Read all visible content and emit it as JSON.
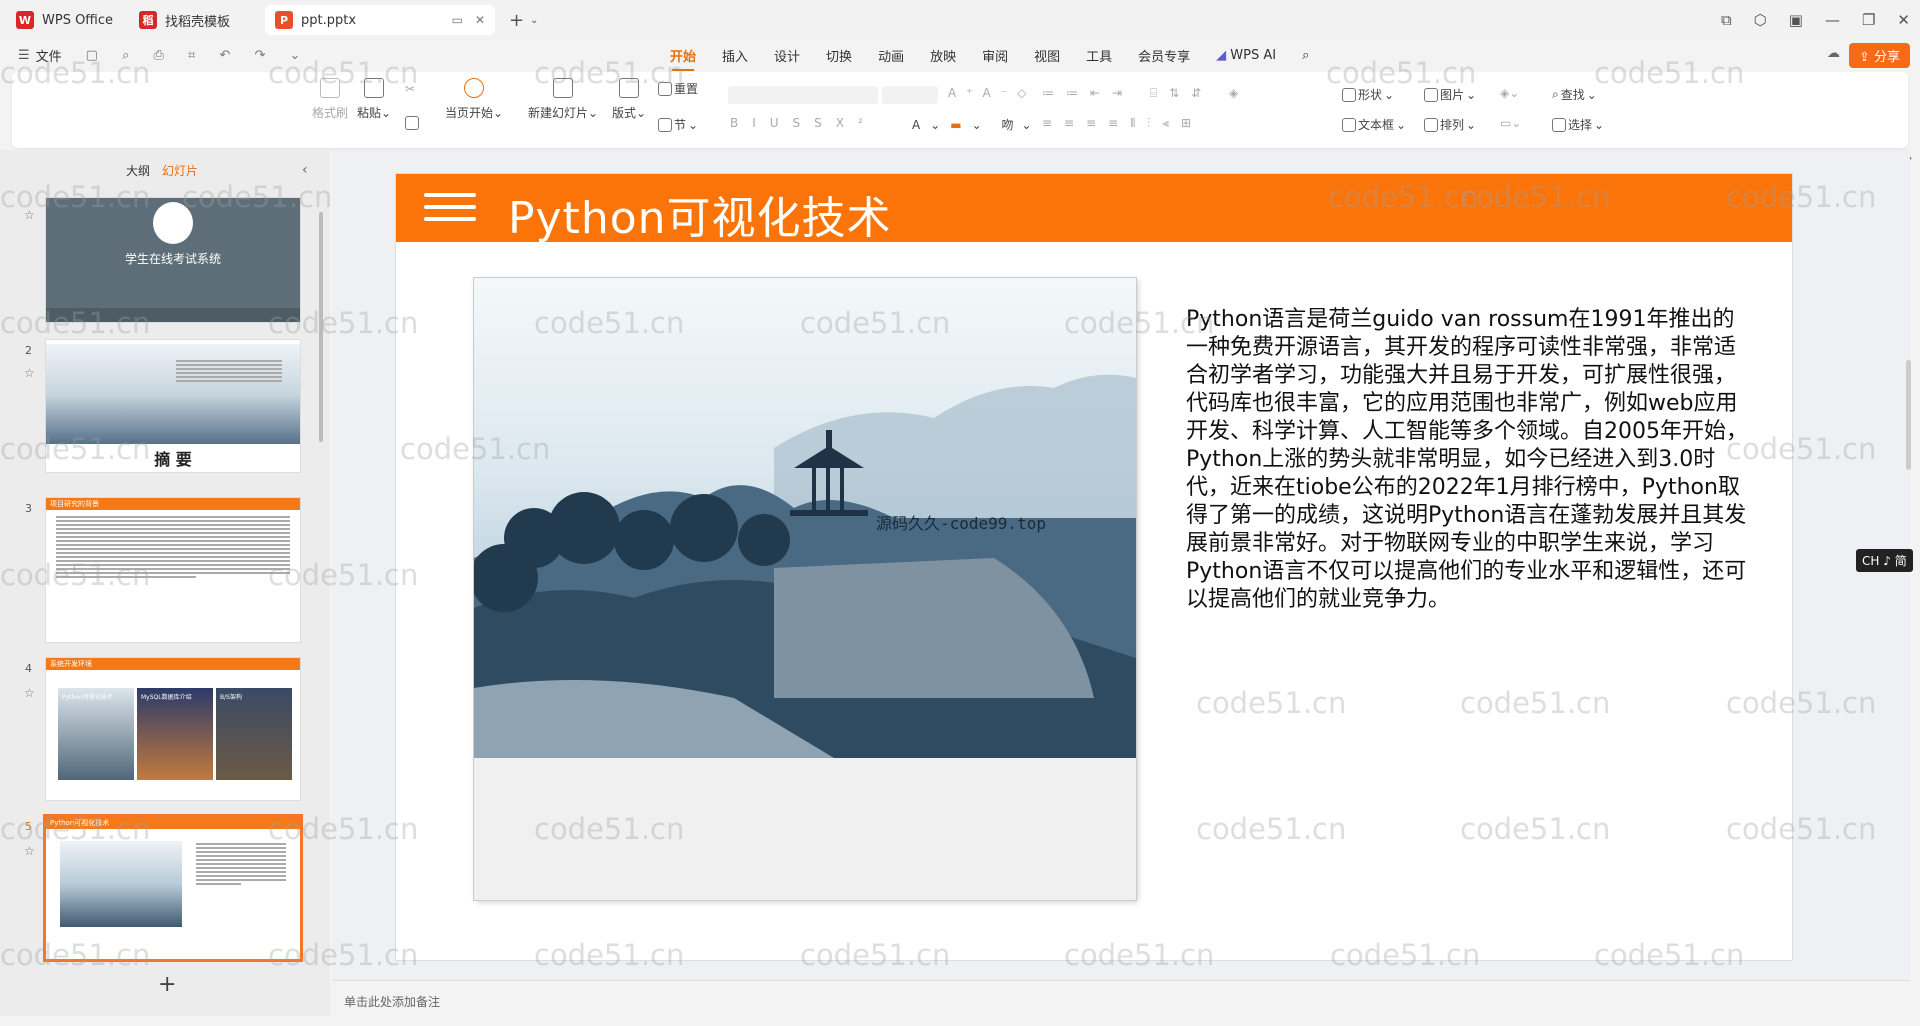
{
  "tabs": [
    {
      "label": "WPS Office",
      "logo": "W",
      "color": "#d9262b"
    },
    {
      "label": "找稻壳模板",
      "logo": "稻",
      "color": "#d9262b"
    },
    {
      "label": "ppt.pptx",
      "logo": "P",
      "color": "#e8502b"
    }
  ],
  "menu": {
    "file": "文件",
    "ribbon_tabs": [
      "开始",
      "插入",
      "设计",
      "切换",
      "动画",
      "放映",
      "审阅",
      "视图",
      "工具",
      "会员专享"
    ],
    "wps_ai": "WPS AI",
    "share": "分享"
  },
  "ribbon": {
    "format_painter": "格式刷",
    "paste": "粘贴",
    "from_current": "当页开始",
    "new_slide": "新建幻灯片",
    "layout": "版式",
    "reset": "重置",
    "section": "节",
    "shape": "形状",
    "picture": "图片",
    "textbox": "文本框",
    "arrange": "排列",
    "find": "查找",
    "select": "选择"
  },
  "sidebar": {
    "outline": "大纲",
    "slides": "幻灯片",
    "thumbs": [
      {
        "num": "",
        "title": "学生在线考试系统"
      },
      {
        "num": "2",
        "title": "摘 要"
      },
      {
        "num": "3",
        "title": "项目研究的背景"
      },
      {
        "num": "4",
        "title": "系统开发环境",
        "panels": [
          "Python可视化技术",
          "MySQL数据库介绍",
          "B/S架构"
        ]
      },
      {
        "num": "5",
        "title": "Python可视化技术"
      }
    ]
  },
  "slide": {
    "title": "Python可视化技术",
    "image_caption": "源码久久-code99.top",
    "body": "Python语言是荷兰guido van rossum在1991年推出的一种免费开源语言，其开发的程序可读性非常强，非常适合初学者学习，功能强大并且易于开发，可扩展性很强，代码库也很丰富，它的应用范围也非常广，例如web应用开发、科学计算、人工智能等多个领域。自2005年开始，Python上涨的势头就非常明显，如今已经进入到3.0时代，近来在tiobe公布的2022年1月排行榜中，Python取得了第一的成绩，这说明Python语言在蓬勃发展并且其发展前景非常好。对于物联网专业的中职学生来说，学习Python语言不仅可以提高他们的专业水平和逻辑性，还可以提高他们的就业竞争力。"
  },
  "notes_placeholder": "单击此处添加备注",
  "ime": "CH ♪ 简",
  "watermark": "code51.cn"
}
